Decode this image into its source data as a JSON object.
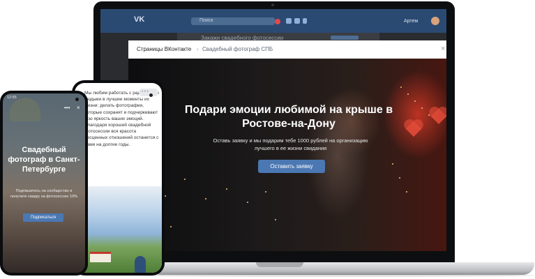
{
  "colors": {
    "vk_header": "#2b4a72",
    "accent_button": "#4b78b3",
    "modal_background": "#1a1b1e"
  },
  "laptop": {
    "vk_header": {
      "logo": "VK",
      "search_placeholder": "Поиск",
      "user_name": "Артем"
    },
    "feed_post_title": "Закажи свадебного фотосессии",
    "modal": {
      "breadcrumb_root": "Страницы ВКонтакте",
      "breadcrumb_separator": "›",
      "breadcrumb_current": "Свадебный фотограф СПБ",
      "close_symbol": "×",
      "hero_title": "Подари эмоции любимой на крыше в Ростове-на-Дону",
      "hero_subtitle": "Оставь заявку и мы подарим тебе 1000 рублей на организацию лучшего в ее жизни свидания",
      "hero_button": "Оставить заявку"
    }
  },
  "phone_middle": {
    "pill_label": "• • •",
    "body_text": "Мы любим работать с радостными людьми в лучшие моменты их жизни: делать фотографии, которые сохранят и подчеркивают всю яркость ваших эмоций. Благодаря хорошей свадебной фотосессии вся красота бесценных отношений останется с вами на долгие годы."
  },
  "phone_front": {
    "status_time": "12:55",
    "menu_symbol": "•••",
    "close_symbol": "×",
    "title": "Свадебный фотограф в Санкт-Петербурге",
    "subtitle": "Подпишитесь на сообщество и получите скидку на фотосессию 10%",
    "button": "Подписаться"
  }
}
